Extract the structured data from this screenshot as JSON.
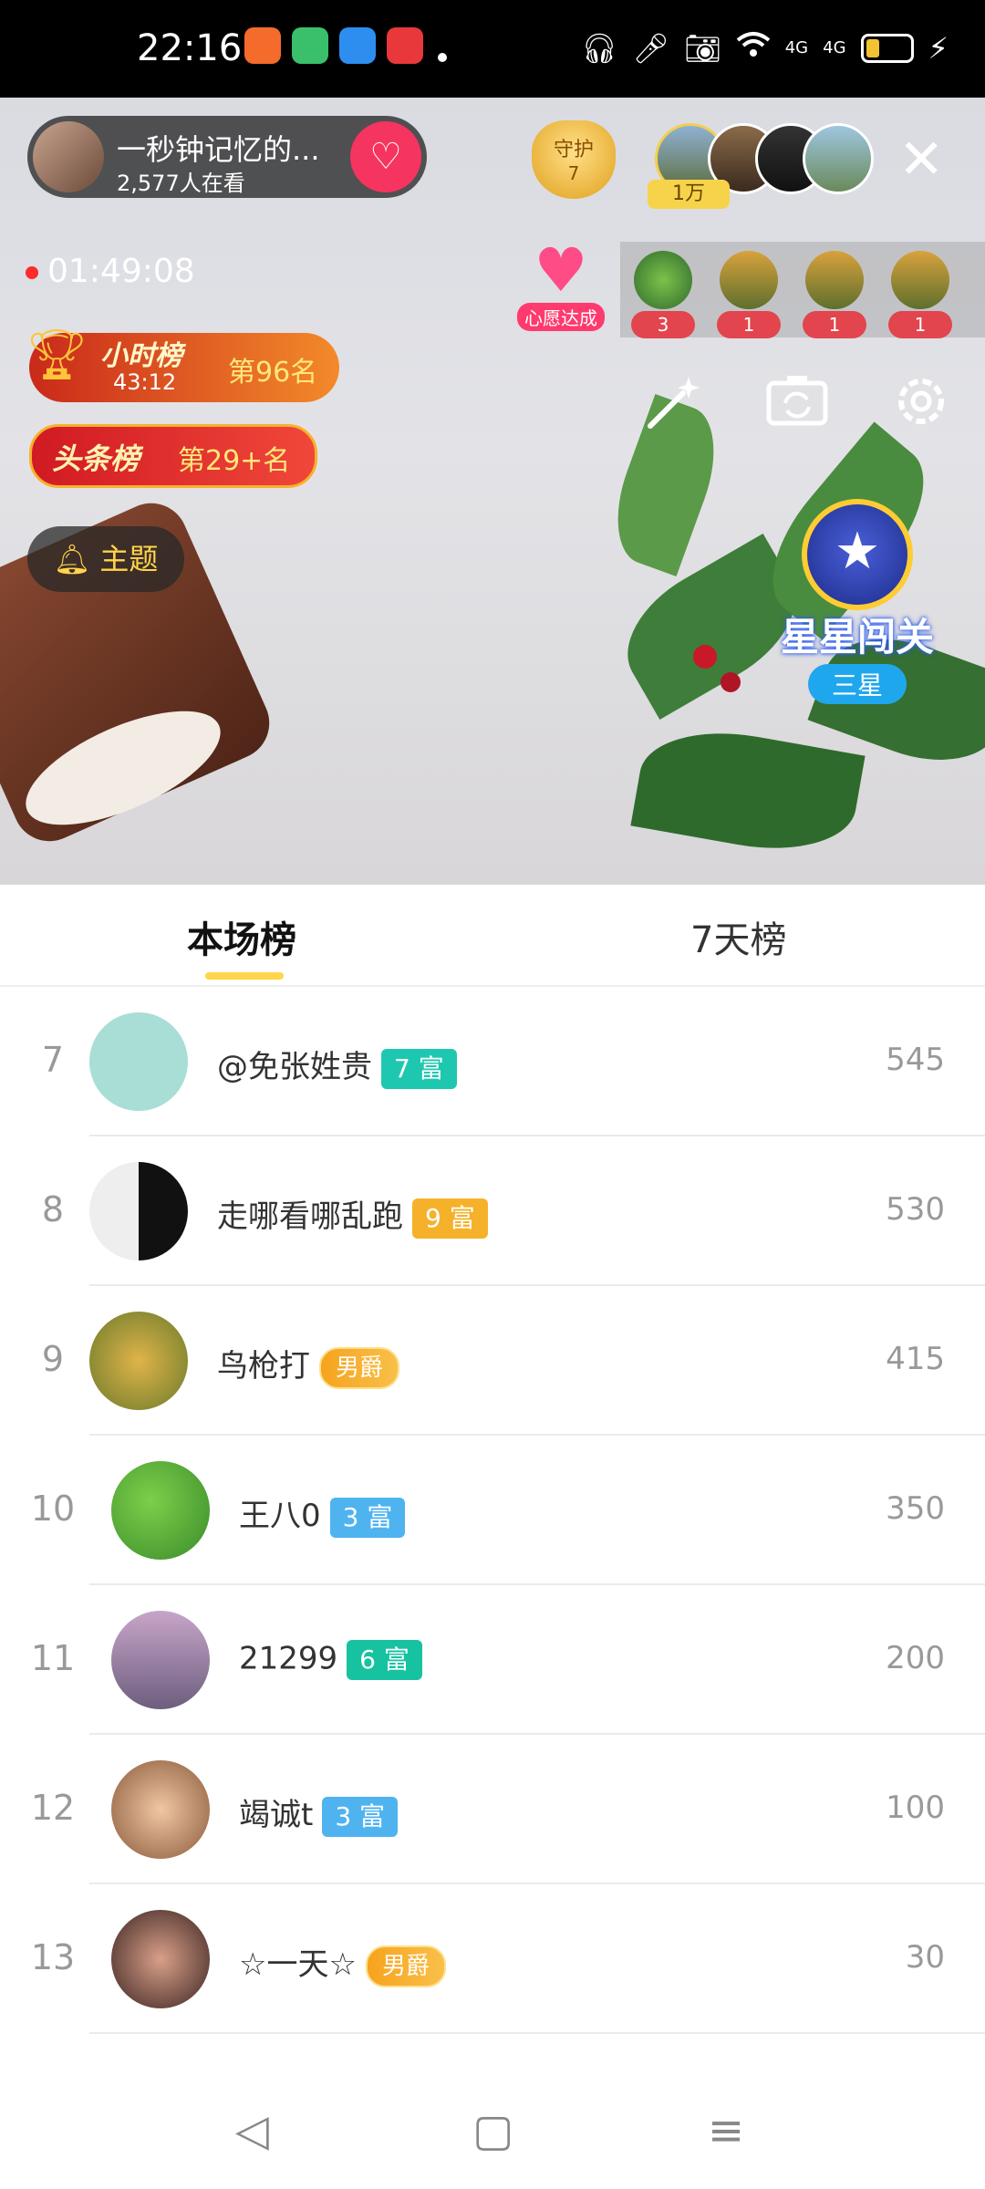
{
  "status_bar": {
    "time": "22:16",
    "right_icons": [
      "headphones-icon",
      "mic-icon",
      "camera-icon",
      "wifi-icon",
      "4g-signal-icon",
      "4g-signal-icon",
      "battery-icon",
      "charging-icon"
    ],
    "signal_labels": [
      "4G",
      "4G"
    ]
  },
  "streamer": {
    "name": "一秒钟记忆的...",
    "viewers": "2,577人在看",
    "follow_icon": "heart-plus-icon"
  },
  "guard": {
    "label": "守护",
    "count": "7"
  },
  "top_fans": {
    "badge": "1万"
  },
  "live_timer": "01:49:08",
  "wish": {
    "label": "心愿达成"
  },
  "gifts": [
    "3",
    "1",
    "1",
    "1"
  ],
  "hour_rank": {
    "title": "小时榜",
    "countdown": "43:12",
    "rank": "第96名"
  },
  "headline_rank": {
    "title": "头条榜",
    "rank": "第29+名"
  },
  "topic_button": "主题",
  "star_pass": {
    "title": "星星闯关",
    "level": "三星"
  },
  "tabs": [
    "本场榜",
    "7天榜"
  ],
  "rankings": [
    {
      "rank": "7",
      "name": "@免张姓贵",
      "badge": "7 富",
      "badge_type": "level",
      "badge_color": "#1ec8b0",
      "score": "545"
    },
    {
      "rank": "8",
      "name": "走哪看哪乱跑",
      "badge": "9 富",
      "badge_type": "level",
      "badge_color": "#f6b12a",
      "score": "530"
    },
    {
      "rank": "9",
      "name": "鸟枪打",
      "badge": "男爵",
      "badge_type": "noble",
      "badge_color": "#f7a31d",
      "score": "415"
    },
    {
      "rank": "10",
      "name": "王八0",
      "badge": "3 富",
      "badge_type": "level",
      "badge_color": "#4fb3f0",
      "score": "350"
    },
    {
      "rank": "11",
      "name": "21299",
      "badge": "6 富",
      "badge_type": "level",
      "badge_color": "#17c2a0",
      "score": "200"
    },
    {
      "rank": "12",
      "name": "竭诚t",
      "badge": "3 富",
      "badge_type": "level",
      "badge_color": "#4fb3f0",
      "score": "100"
    },
    {
      "rank": "13",
      "name": "☆一天☆",
      "badge": "男爵",
      "badge_type": "noble",
      "badge_color": "#f7a31d",
      "score": "30"
    }
  ],
  "colors": {
    "accent": "#ffd54a",
    "follow": "#f5345f",
    "rank_text": "#999999"
  }
}
